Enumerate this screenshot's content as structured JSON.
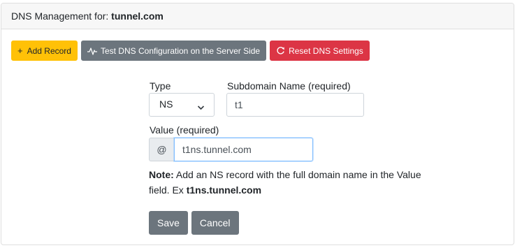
{
  "header": {
    "prefix": "DNS Management for: ",
    "domain": "tunnel.com"
  },
  "toolbar": {
    "add_label": "Add Record",
    "test_label": "Test DNS Configuration on the Server Side",
    "reset_label": "Reset DNS Settings",
    "add_icon": "plus-icon",
    "test_icon": "pulse-icon",
    "reset_icon": "refresh-icon"
  },
  "form": {
    "type_label": "Type",
    "type_value": "NS",
    "subdomain_label": "Subdomain Name (required)",
    "subdomain_value": "t1",
    "value_label": "Value (required)",
    "value_addon": "@",
    "value_value": "t1ns.tunnel.com",
    "note_prefix": "Note:",
    "note_text": " Add an NS record with the full domain name in the Value field. Ex ",
    "note_example": "t1ns.tunnel.com"
  },
  "actions": {
    "save_label": "Save",
    "cancel_label": "Cancel"
  },
  "colors": {
    "warning": "#ffc107",
    "secondary": "#6c757d",
    "danger": "#dc3545",
    "focus": "#80bdff"
  }
}
